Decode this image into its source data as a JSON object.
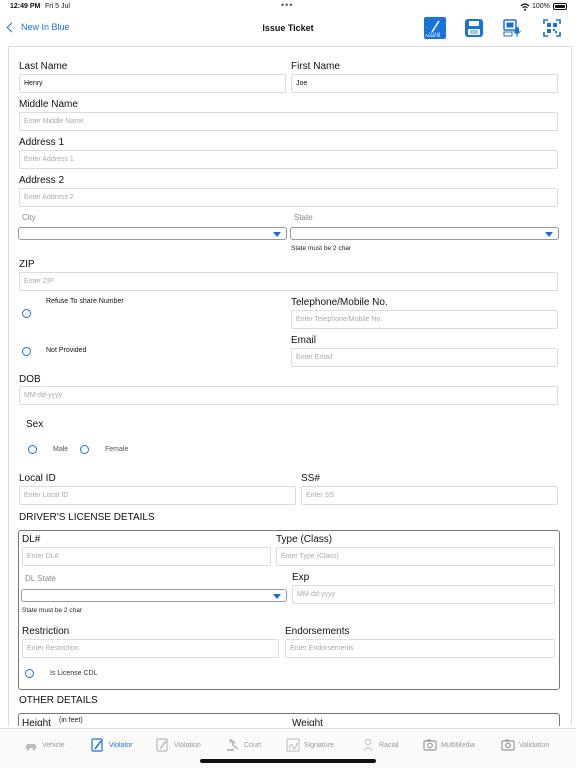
{
  "status": {
    "time": "12:49 PM",
    "date": "Fri 5 Jul",
    "battery": "100%"
  },
  "nav": {
    "back_label": "New In Blue",
    "title": "Issue Ticket",
    "autofill_label": "AutoFill"
  },
  "form": {
    "last_name": {
      "label": "Last Name",
      "value": "Henry"
    },
    "first_name": {
      "label": "First Name",
      "value": "Joe"
    },
    "middle_name": {
      "label": "Middle Name",
      "placeholder": "Enter Middle Name"
    },
    "address1": {
      "label": "Address 1",
      "placeholder": "Enter Address 1"
    },
    "address2": {
      "label": "Address 2",
      "placeholder": "Enter Address 2"
    },
    "city": {
      "label": "City"
    },
    "state": {
      "label": "State",
      "hint": "State must be 2 char"
    },
    "zip": {
      "label": "ZIP",
      "placeholder": "Enter ZIP"
    },
    "refuse_label": "Refuse To share Number",
    "telephone": {
      "label": "Telephone/Mobile No.",
      "placeholder": "Enter Telephone/Mobile No."
    },
    "not_provided_label": "Not Provided",
    "email": {
      "label": "Email",
      "placeholder": "Enter Email"
    },
    "dob": {
      "label": "DOB",
      "placeholder": "MM-dd-yyyy"
    },
    "sex": {
      "label": "Sex",
      "male": "Male",
      "female": "Female"
    },
    "local_id": {
      "label": "Local ID",
      "placeholder": "Enter Local ID"
    },
    "ss": {
      "label": "SS#",
      "placeholder": "Enter SS"
    }
  },
  "license": {
    "section_title": "DRIVER'S LICENSE DETAILS",
    "dl": {
      "label": "DL#",
      "placeholder": "Enter DL#"
    },
    "type": {
      "label": "Type (Class)",
      "placeholder": "Enter Type (Class)"
    },
    "dl_state": {
      "label": "DL State",
      "hint": "State must be 2 char"
    },
    "exp": {
      "label": "Exp",
      "placeholder": "MM-dd-yyyy"
    },
    "restriction": {
      "label": "Restriction",
      "placeholder": "Enter Restriction"
    },
    "endorsements": {
      "label": "Endorsements",
      "placeholder": "Enter Endorsements"
    },
    "cdl_label": "Is License CDL"
  },
  "other": {
    "section_title": "OTHER DETAILS",
    "height_label": "Height",
    "height_unit": "(in feet)",
    "weight_label": "Weight"
  },
  "tabs": [
    {
      "label": "Vehicle",
      "icon": "car-icon"
    },
    {
      "label": "Violator",
      "icon": "violator-icon"
    },
    {
      "label": "Violation",
      "icon": "violation-icon"
    },
    {
      "label": "Court",
      "icon": "gavel-icon"
    },
    {
      "label": "Signature",
      "icon": "signature-icon"
    },
    {
      "label": "Racial",
      "icon": "person-icon"
    },
    {
      "label": "MultiMedia",
      "icon": "camera-icon"
    },
    {
      "label": "Validation",
      "icon": "camera-icon"
    }
  ],
  "colors": {
    "accent": "#1a73d9"
  }
}
